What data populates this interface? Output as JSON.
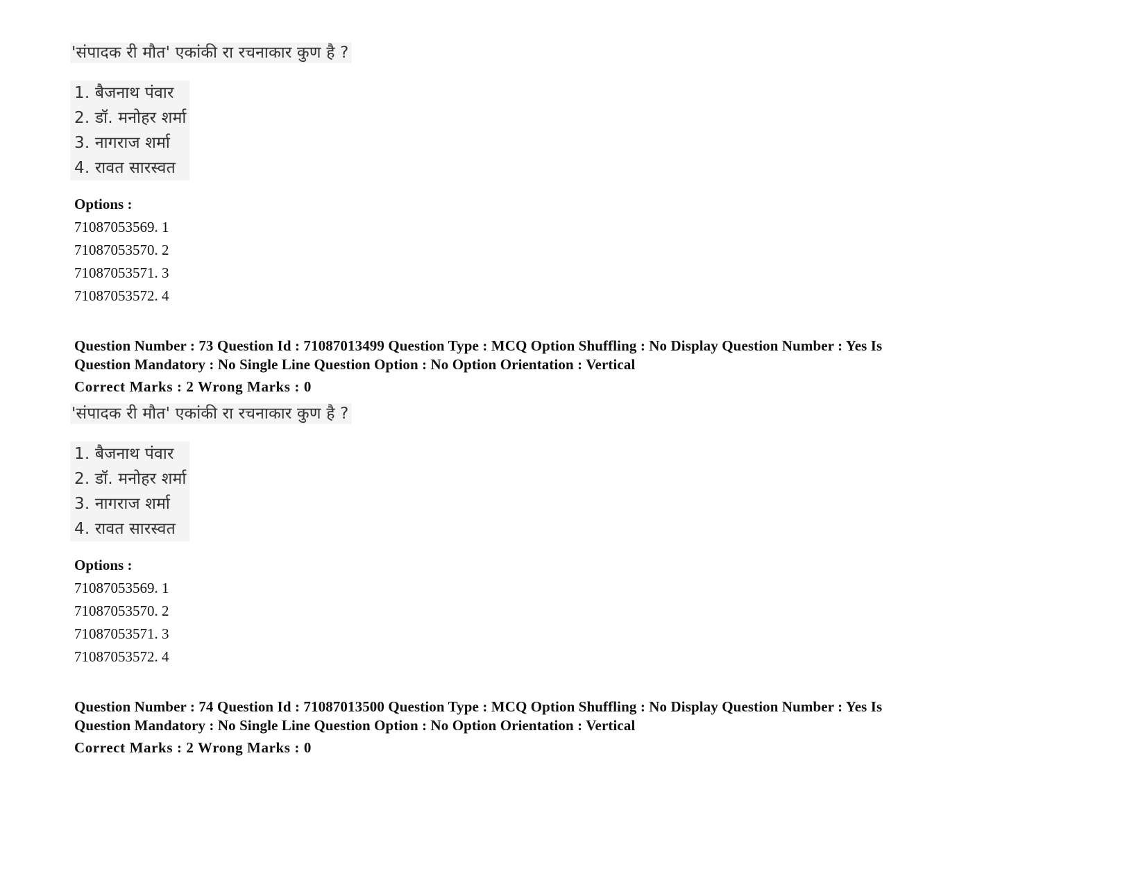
{
  "document": {
    "top_question": {
      "question_text": "'संपादक री मौत' एकांकी रा रचनाकार कुण है ?",
      "choices": [
        "1. बैजनाथ पंवार",
        "2. डॉ. मनोहर शर्मा",
        "3. नागराज शर्मा",
        "4. रावत सारस्वत"
      ],
      "options_label": "Options :",
      "options": [
        "71087053569. 1",
        "71087053570. 2",
        "71087053571. 3",
        "71087053572. 4"
      ]
    },
    "question_73": {
      "meta_line1": "Question Number : 73 Question Id : 71087013499 Question Type : MCQ Option Shuffling : No Display Question Number : Yes Is",
      "meta_line2": "Question Mandatory : No Single Line Question Option : No Option Orientation : Vertical",
      "marks": "Correct Marks : 2 Wrong Marks : 0",
      "question_text": "'संपादक री मौत' एकांकी रा रचनाकार कुण है ?",
      "choices": [
        "1. बैजनाथ पंवार",
        "2. डॉ. मनोहर शर्मा",
        "3. नागराज शर्मा",
        "4. रावत सारस्वत"
      ],
      "options_label": "Options :",
      "options": [
        "71087053569. 1",
        "71087053570. 2",
        "71087053571. 3",
        "71087053572. 4"
      ]
    },
    "question_74": {
      "meta_line1": "Question Number : 74 Question Id : 71087013500 Question Type : MCQ Option Shuffling : No Display Question Number : Yes Is",
      "meta_line2": "Question Mandatory : No Single Line Question Option : No Option Orientation : Vertical",
      "marks": "Correct Marks : 2 Wrong Marks : 0"
    }
  }
}
